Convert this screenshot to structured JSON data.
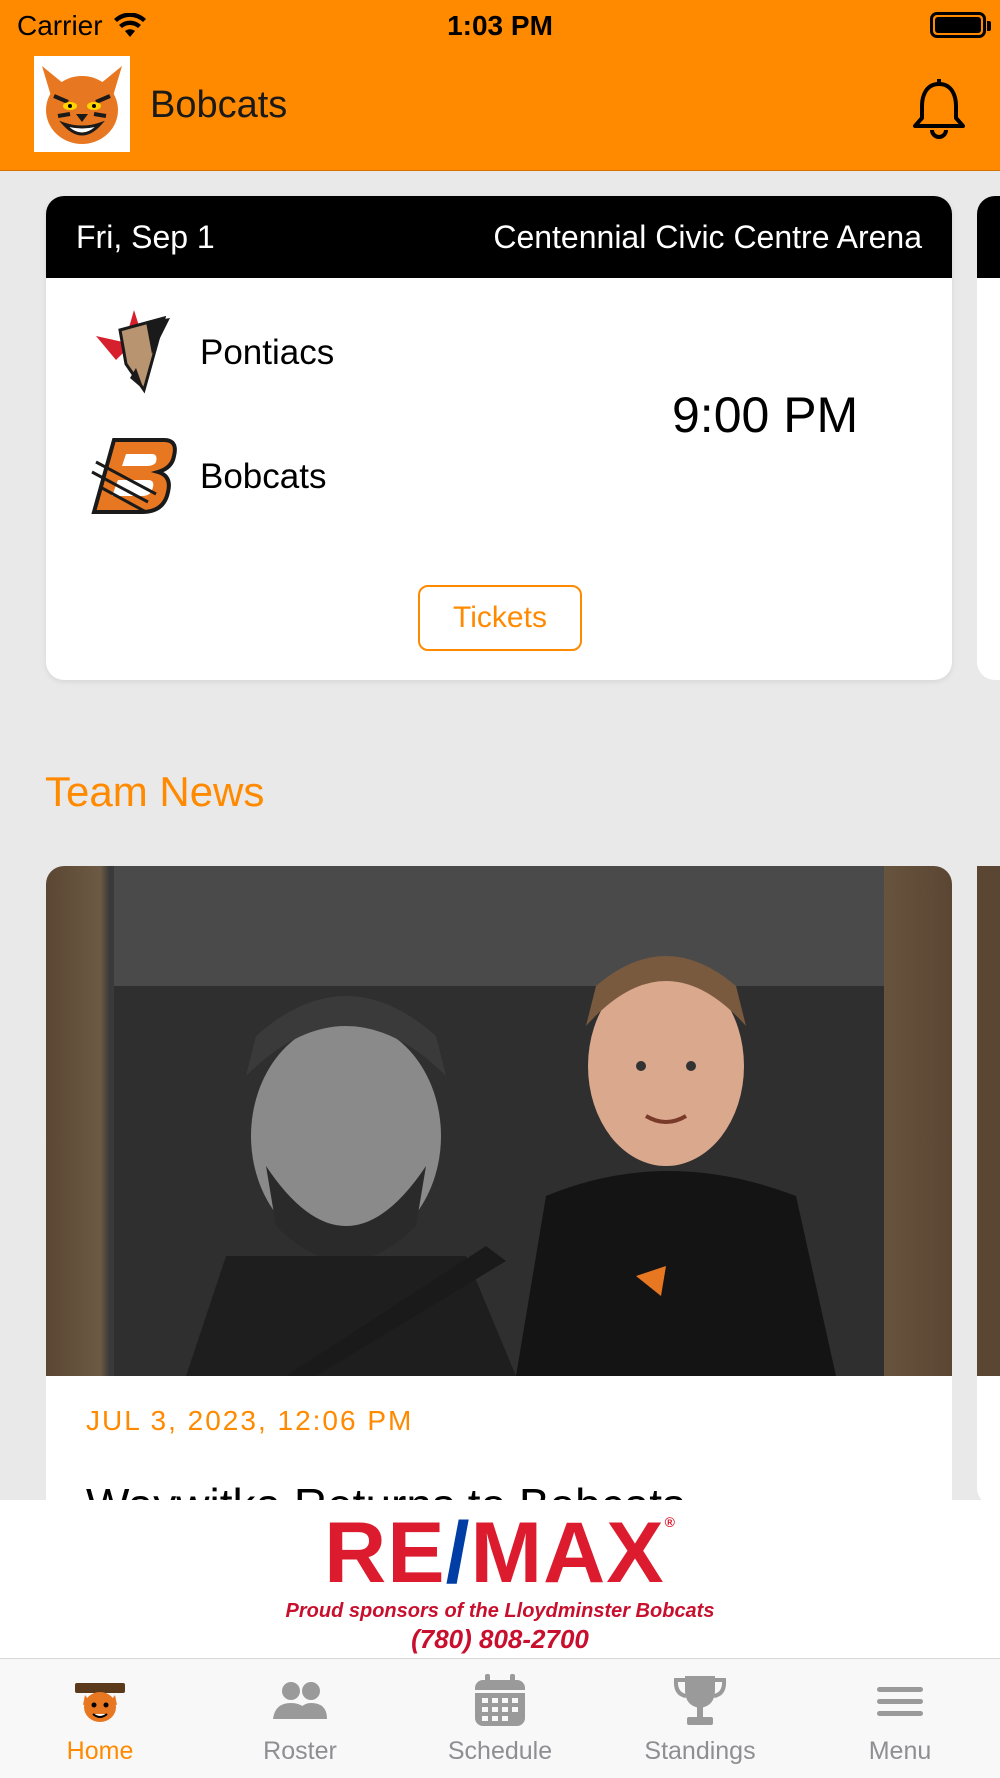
{
  "status_bar": {
    "carrier": "Carrier",
    "time": "1:03 PM"
  },
  "header": {
    "title": "Bobcats"
  },
  "game": {
    "date": "Fri, Sep 1",
    "venue": "Centennial Civic Centre Arena",
    "home_team": "Pontiacs",
    "away_team": "Bobcats",
    "time": "9:00 PM",
    "tickets_label": "Tickets"
  },
  "news": {
    "section_title": "Team News",
    "date": "JUL 3, 2023, 12:06 PM",
    "headline": "Waywitka Returns to Bobcats"
  },
  "sponsor": {
    "brand_left": "RE",
    "brand_slash": "/",
    "brand_right": "MAX",
    "registered": "®",
    "tagline": "Proud sponsors of the Lloydminster Bobcats",
    "phone": "(780) 808-2700"
  },
  "tabs": [
    {
      "label": "Home",
      "icon": "bobcats-logo-icon",
      "active": true
    },
    {
      "label": "Roster",
      "icon": "people-icon",
      "active": false
    },
    {
      "label": "Schedule",
      "icon": "calendar-icon",
      "active": false
    },
    {
      "label": "Standings",
      "icon": "trophy-icon",
      "active": false
    },
    {
      "label": "Menu",
      "icon": "hamburger-icon",
      "active": false
    }
  ],
  "colors": {
    "accent": "#ff8a00",
    "header_black": "#000000",
    "tab_inactive": "#8e8e93",
    "remax_red": "#dc1c2e",
    "remax_blue": "#003da5"
  }
}
